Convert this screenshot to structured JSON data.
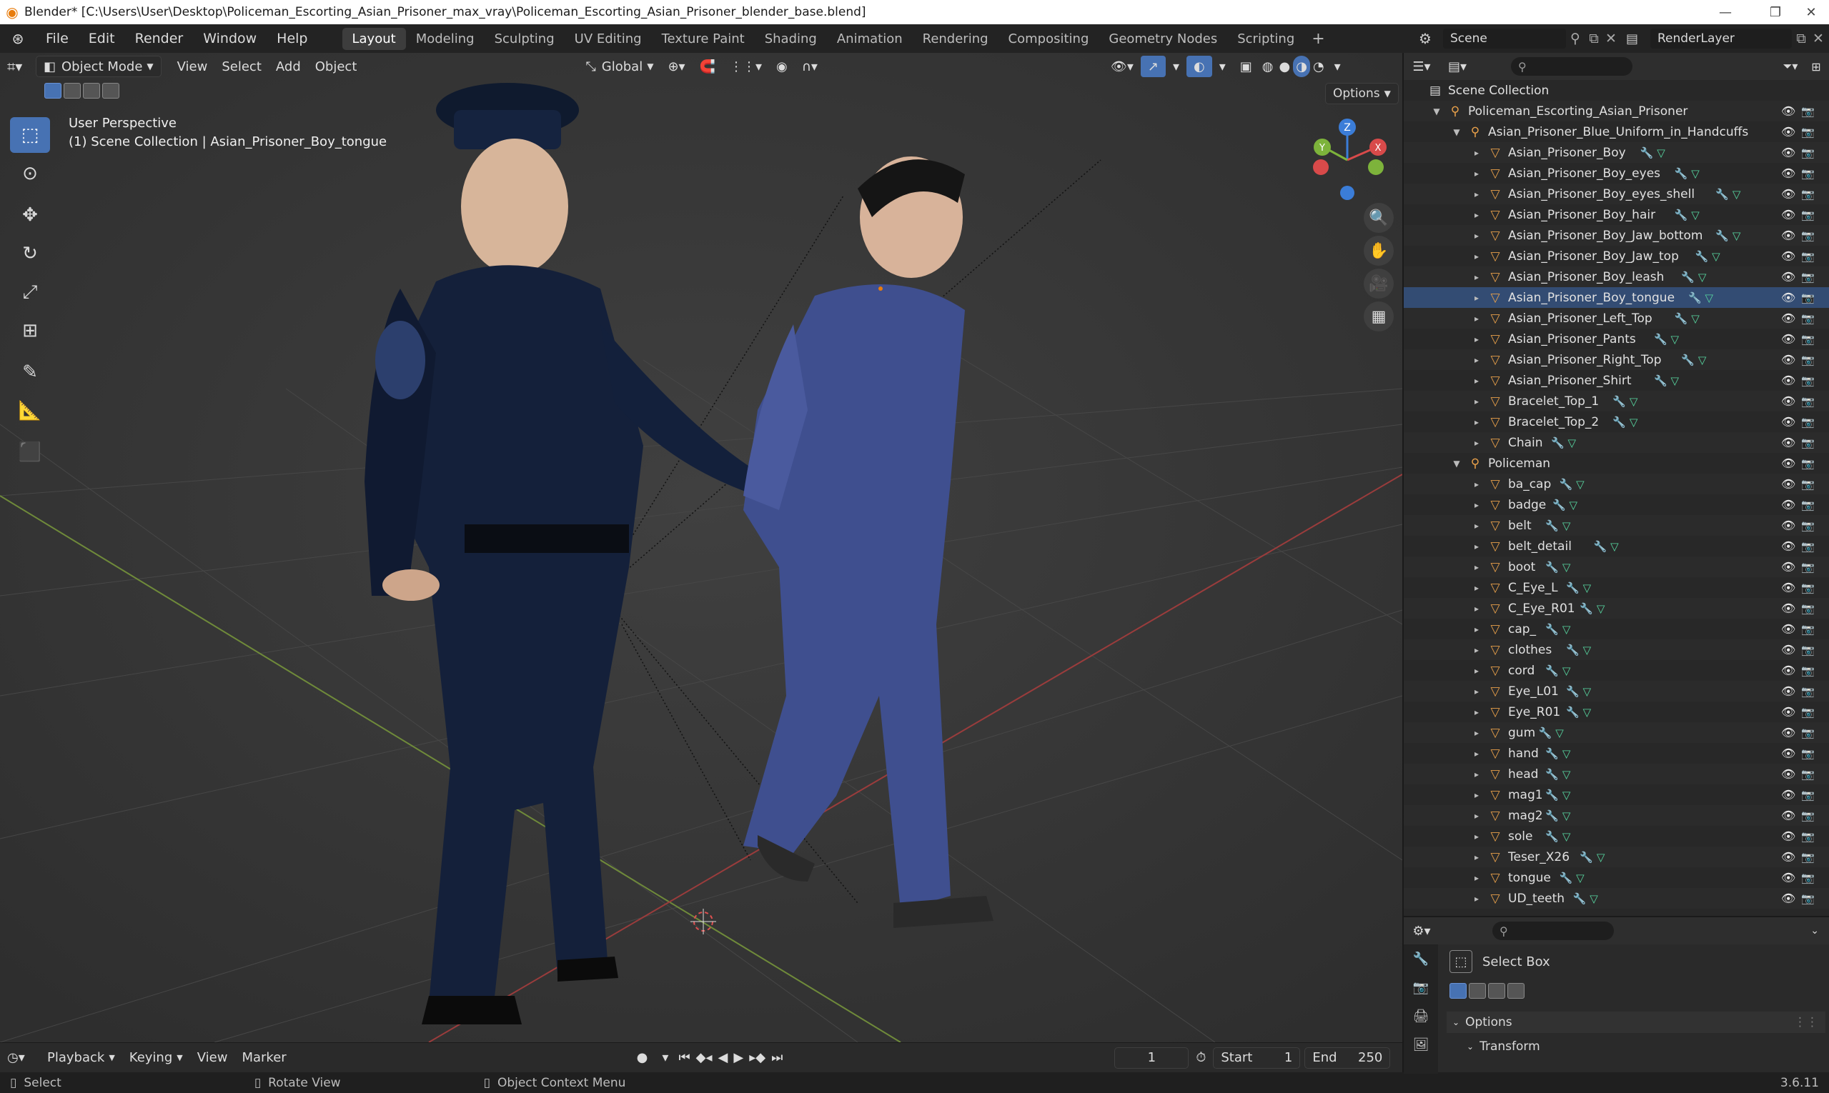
{
  "window": {
    "title": "Blender* [C:\\Users\\User\\Desktop\\Policeman_Escorting_Asian_Prisoner_max_vray\\Policeman_Escorting_Asian_Prisoner_blender_base.blend]"
  },
  "menu": [
    "File",
    "Edit",
    "Render",
    "Window",
    "Help"
  ],
  "workspaces": [
    "Layout",
    "Modeling",
    "Sculpting",
    "UV Editing",
    "Texture Paint",
    "Shading",
    "Animation",
    "Rendering",
    "Compositing",
    "Geometry Nodes",
    "Scripting"
  ],
  "active_workspace": "Layout",
  "scene_name": "Scene",
  "view_layer": "RenderLayer",
  "viewport": {
    "mode": "Object Mode",
    "menus": [
      "View",
      "Select",
      "Add",
      "Object"
    ],
    "orientation": "Global",
    "options_label": "Options",
    "info_line1": "User Perspective",
    "info_line2": "(1) Scene Collection | Asian_Prisoner_Boy_tongue",
    "gizmo_axes": {
      "z": "Z",
      "y": "Y",
      "x": "X"
    }
  },
  "outliner": {
    "root": "Scene Collection",
    "collection1": "Policeman_Escorting_Asian_Prisoner",
    "group1": "Asian_Prisoner_Blue_Uniform_in_Handcuffs",
    "group1_items": [
      "Asian_Prisoner_Boy",
      "Asian_Prisoner_Boy_eyes",
      "Asian_Prisoner_Boy_eyes_shell",
      "Asian_Prisoner_Boy_hair",
      "Asian_Prisoner_Boy_Jaw_bottom",
      "Asian_Prisoner_Boy_Jaw_top",
      "Asian_Prisoner_Boy_leash",
      "Asian_Prisoner_Boy_tongue",
      "Asian_Prisoner_Left_Top",
      "Asian_Prisoner_Pants",
      "Asian_Prisoner_Right_Top",
      "Asian_Prisoner_Shirt",
      "Bracelet_Top_1",
      "Bracelet_Top_2",
      "Chain"
    ],
    "group2": "Policeman",
    "group2_items": [
      "ba_cap",
      "badge",
      "belt",
      "belt_detail",
      "boot",
      "C_Eye_L",
      "C_Eye_R01",
      "cap_",
      "clothes",
      "cord",
      "Eye_L01",
      "Eye_R01",
      "gum",
      "hand",
      "head",
      "mag1",
      "mag2",
      "sole",
      "Teser_X26",
      "tongue",
      "UD_teeth"
    ],
    "active_item": "Asian_Prisoner_Boy_tongue"
  },
  "properties": {
    "tool_name": "Select Box",
    "options_label": "Options",
    "transform_label": "Transform"
  },
  "timeline": {
    "menus": [
      "Playback",
      "Keying",
      "View",
      "Marker"
    ],
    "current_frame": "1",
    "start_label": "Start",
    "start_value": "1",
    "end_label": "End",
    "end_value": "250"
  },
  "statusbar": {
    "select": "Select",
    "rotate": "Rotate View",
    "context": "Object Context Menu",
    "version": "3.6.11"
  },
  "colors": {
    "accent": "#4772b3",
    "orange_icon": "#e8a04a",
    "mesh_icon": "#e8a04a",
    "modifier_icon": "#6e9ee0",
    "data_icon": "#57d6a0"
  }
}
